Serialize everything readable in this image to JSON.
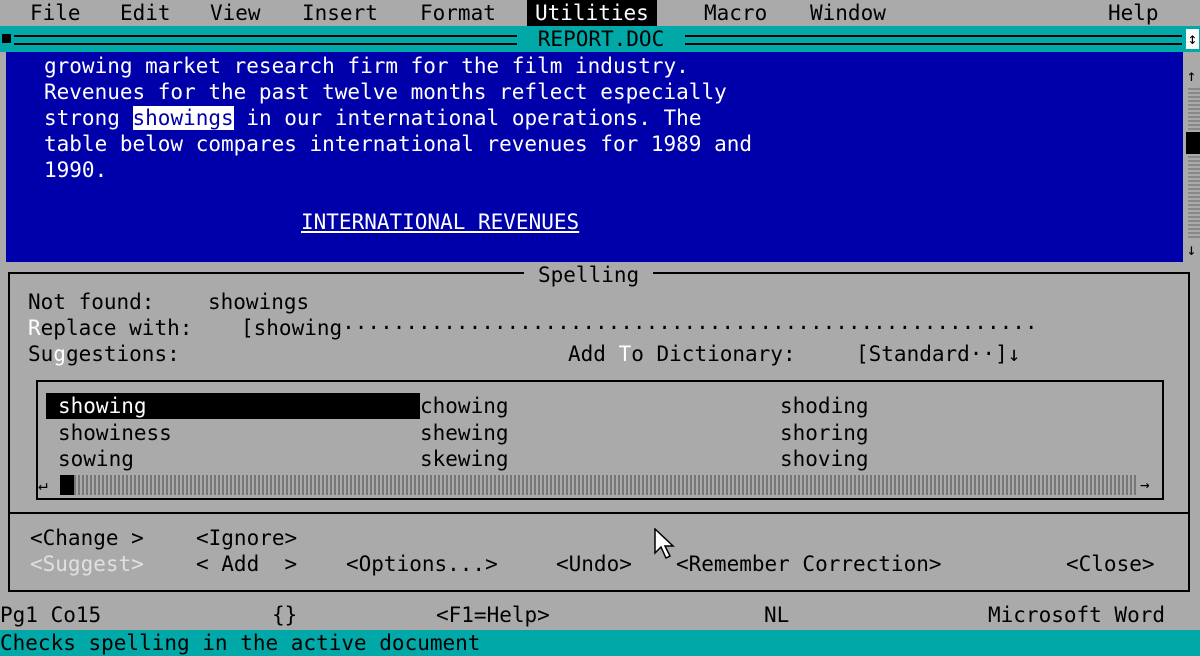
{
  "menu": {
    "items": [
      "File",
      "Edit",
      "View",
      "Insert",
      "Format",
      "Utilities",
      "Macro",
      "Window",
      "Help"
    ],
    "active": "Utilities"
  },
  "window": {
    "title": "REPORT.DOC"
  },
  "document": {
    "lines": [
      "growing market research firm for the film industry.",
      "Revenues for the past twelve months reflect especially",
      "strong ",
      "table below compares international revenues for 1989 and",
      "1990."
    ],
    "highlighted_word": "showings",
    "line3_rest": " in our international operations. The",
    "heading": "INTERNATIONAL REVENUES"
  },
  "spelling": {
    "title": "Spelling",
    "not_found_label": "Not found:",
    "not_found_value": "showings",
    "replace_label_hot": "R",
    "replace_label_rest": "eplace with:",
    "replace_value": "[showing································································]",
    "suggestions_label_a": "Su",
    "suggestions_label_hot": "g",
    "suggestions_label_b": "gestions:",
    "add_to_label_a": "Add ",
    "add_to_label_hot": "T",
    "add_to_label_b": "o Dictionary:",
    "dictionary_value": "[Standard··]↓",
    "suggestions": [
      "showing",
      "chowing",
      "shoding",
      "showiness",
      "shewing",
      "shoring",
      "sowing",
      "skewing",
      "shoving"
    ],
    "selected_suggestion": "showing"
  },
  "buttons": {
    "change": "<Change >",
    "ignore": "<Ignore>",
    "suggest": "<Suggest>",
    "add": "< Add  >",
    "options": "<Options...>",
    "undo": "<Undo>",
    "remember": "<Remember Correction>",
    "close": "<Close>"
  },
  "status": {
    "page_col": "Pg1 Co15",
    "braces": "{}",
    "help": "<F1=Help>",
    "mode": "NL",
    "app": "Microsoft Word",
    "message": "Checks spelling in the active document"
  },
  "colors": {
    "doc_bg": "#0000aa",
    "title_bar": "#00a8a8",
    "dialog_bg": "#aaaaaa"
  }
}
